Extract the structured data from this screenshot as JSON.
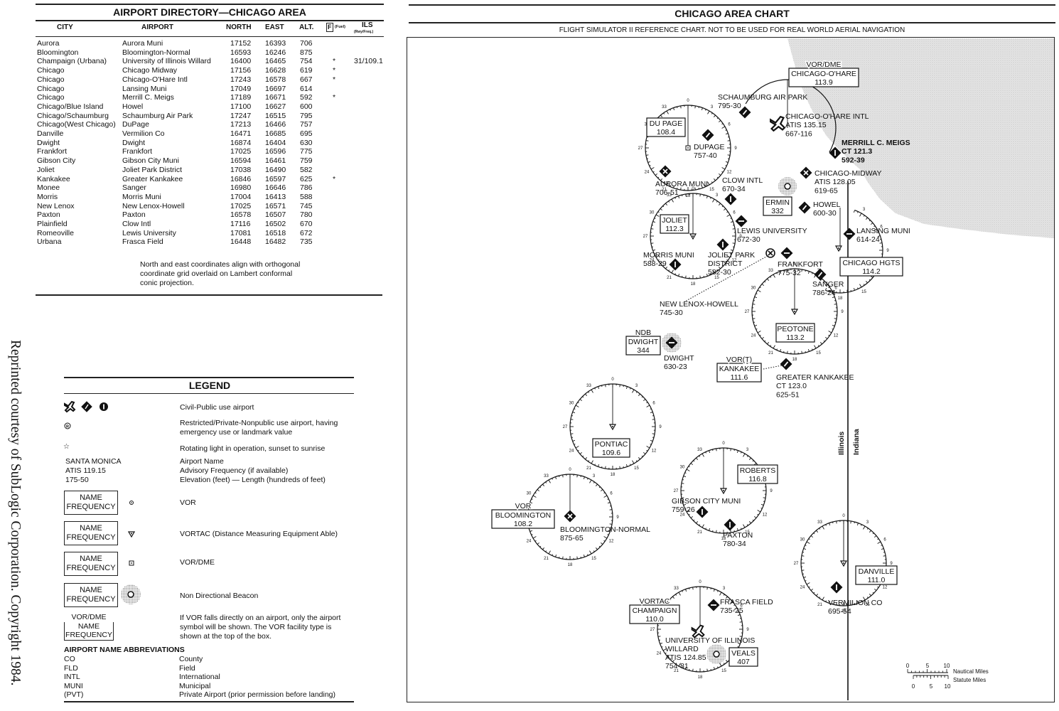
{
  "credit": "Reprinted courtesy of SubLogic Corporation. Copyright 1984.",
  "directory": {
    "title": "AIRPORT DIRECTORY—CHICAGO AREA",
    "columns": [
      "CITY",
      "AIRPORT",
      "NORTH",
      "EAST",
      "ALT.",
      "F",
      "(Fuel)",
      "ILS",
      "(Rwy/Freq.)"
    ],
    "rows": [
      {
        "city": "Aurora",
        "airport": "Aurora Muni",
        "north": "17152",
        "east": "16393",
        "alt": "706",
        "fuel": "",
        "ils": ""
      },
      {
        "city": "Bloomington",
        "airport": "Bloomington-Normal",
        "north": "16593",
        "east": "16246",
        "alt": "875",
        "fuel": "",
        "ils": ""
      },
      {
        "city": "Champaign (Urbana)",
        "airport": "University of Illinois Willard",
        "north": "16400",
        "east": "16465",
        "alt": "754",
        "fuel": "*",
        "ils": "31/109.1"
      },
      {
        "city": "Chicago",
        "airport": "Chicago Midway",
        "north": "17156",
        "east": "16628",
        "alt": "619",
        "fuel": "*",
        "ils": ""
      },
      {
        "city": "Chicago",
        "airport": "Chicago-O'Hare Intl",
        "north": "17243",
        "east": "16578",
        "alt": "667",
        "fuel": "*",
        "ils": ""
      },
      {
        "city": "Chicago",
        "airport": "Lansing Muni",
        "north": "17049",
        "east": "16697",
        "alt": "614",
        "fuel": "",
        "ils": ""
      },
      {
        "city": "Chicago",
        "airport": "Merrill C. Meigs",
        "north": "17189",
        "east": "16671",
        "alt": "592",
        "fuel": "*",
        "ils": ""
      },
      {
        "city": "Chicago/Blue Island",
        "airport": "Howel",
        "north": "17100",
        "east": "16627",
        "alt": "600",
        "fuel": "",
        "ils": ""
      },
      {
        "city": "Chicago/Schaumburg",
        "airport": "Schaumburg Air Park",
        "north": "17247",
        "east": "16515",
        "alt": "795",
        "fuel": "",
        "ils": ""
      },
      {
        "city": "Chicago(West Chicago)",
        "airport": "DuPage",
        "north": "17213",
        "east": "16466",
        "alt": "757",
        "fuel": "",
        "ils": ""
      },
      {
        "city": "Danville",
        "airport": "Vermilion Co",
        "north": "16471",
        "east": "16685",
        "alt": "695",
        "fuel": "",
        "ils": ""
      },
      {
        "city": "Dwight",
        "airport": "Dwight",
        "north": "16874",
        "east": "16404",
        "alt": "630",
        "fuel": "",
        "ils": ""
      },
      {
        "city": "Frankfort",
        "airport": "Frankfort",
        "north": "17025",
        "east": "16596",
        "alt": "775",
        "fuel": "",
        "ils": ""
      },
      {
        "city": "Gibson City",
        "airport": "Gibson City Muni",
        "north": "16594",
        "east": "16461",
        "alt": "759",
        "fuel": "",
        "ils": ""
      },
      {
        "city": "Joliet",
        "airport": "Joliet Park District",
        "north": "17038",
        "east": "16490",
        "alt": "582",
        "fuel": "",
        "ils": ""
      },
      {
        "city": "Kankakee",
        "airport": "Greater Kankakee",
        "north": "16846",
        "east": "16597",
        "alt": "625",
        "fuel": "*",
        "ils": ""
      },
      {
        "city": "Monee",
        "airport": "Sanger",
        "north": "16980",
        "east": "16646",
        "alt": "786",
        "fuel": "",
        "ils": ""
      },
      {
        "city": "Morris",
        "airport": "Morris Muni",
        "north": "17004",
        "east": "16413",
        "alt": "588",
        "fuel": "",
        "ils": ""
      },
      {
        "city": "New Lenox",
        "airport": "New Lenox-Howell",
        "north": "17025",
        "east": "16571",
        "alt": "745",
        "fuel": "",
        "ils": ""
      },
      {
        "city": "Paxton",
        "airport": "Paxton",
        "north": "16578",
        "east": "16507",
        "alt": "780",
        "fuel": "",
        "ils": ""
      },
      {
        "city": "Plainfield",
        "airport": "Clow Intl",
        "north": "17116",
        "east": "16502",
        "alt": "670",
        "fuel": "",
        "ils": ""
      },
      {
        "city": "Romeoville",
        "airport": "Lewis University",
        "north": "17081",
        "east": "16518",
        "alt": "672",
        "fuel": "",
        "ils": ""
      },
      {
        "city": "Urbana",
        "airport": "Frasca Field",
        "north": "16448",
        "east": "16482",
        "alt": "735",
        "fuel": "",
        "ils": ""
      }
    ],
    "note": "North and east coordinates align with orthogonal coordinate grid overlaid on Lambert conformal conic projection."
  },
  "legend": {
    "title": "LEGEND",
    "items": [
      {
        "symbol": "civil-airport-icons",
        "text": "Civil-Public use airport"
      },
      {
        "symbol": "restricted-airport-icon",
        "text": "Restricted/Private-Nonpublic use airport, having emergency use or landmark value"
      },
      {
        "symbol": "rotating-light-icon",
        "text": "Rotating light in operation, sunset to sunrise"
      },
      {
        "symbol": "airport-label-example",
        "example_lines": [
          "SANTA MONICA",
          "ATIS 119.15",
          "175-50"
        ],
        "text_lines": [
          "Airport Name",
          "Advisory Frequency (if available)",
          "Elevation (feet) — Length (hundreds of feet)"
        ]
      },
      {
        "symbol": "vor-icon",
        "box": [
          "NAME",
          "FREQUENCY"
        ],
        "text": "VOR"
      },
      {
        "symbol": "vortac-icon",
        "box": [
          "NAME",
          "FREQUENCY"
        ],
        "text": "VORTAC (Distance Measuring Equipment Able)"
      },
      {
        "symbol": "vor-dme-icon",
        "box": [
          "NAME",
          "FREQUENCY"
        ],
        "text": "VOR/DME"
      },
      {
        "symbol": "ndb-icon",
        "box": [
          "NAME",
          "FREQUENCY"
        ],
        "text": "Non Directional Beacon"
      },
      {
        "symbol": "facility-box",
        "box": [
          "VOR/DME",
          "NAME",
          "FREQUENCY"
        ],
        "text": "If VOR falls directly on an airport, only the airport symbol will be shown. The VOR facility type is shown at the top of the box."
      }
    ],
    "abbr_title": "AIRPORT NAME ABBREVIATIONS",
    "abbreviations": [
      {
        "abbr": "CO",
        "meaning": "County"
      },
      {
        "abbr": "FLD",
        "meaning": "Field"
      },
      {
        "abbr": "INTL",
        "meaning": "International"
      },
      {
        "abbr": "MUNI",
        "meaning": "Municipal"
      },
      {
        "abbr": "(PVT)",
        "meaning": "Private Airport (prior permission before landing)"
      }
    ]
  },
  "chart": {
    "title": "CHICAGO AREA CHART",
    "subtitle": "FLIGHT SIMULATOR II REFERENCE CHART.   NOT TO BE USED FOR REAL WORLD AERIAL NAVIGATION",
    "state_labels": [
      "Illinois",
      "Indiana"
    ],
    "compass_ticks": [
      "0",
      "3",
      "6",
      "9",
      "12",
      "15",
      "18",
      "21",
      "24",
      "27",
      "30",
      "33"
    ],
    "navaids": [
      {
        "type": "VOR/DME",
        "name": "CHICAGO-O'HARE",
        "freq": "113.9"
      },
      {
        "type": "VOR/DME",
        "name": "DU PAGE",
        "freq": "108.4"
      },
      {
        "type": "NDB",
        "name": "ERMIN",
        "freq": "332"
      },
      {
        "type": "VORTAC",
        "name": "JOLIET",
        "freq": "112.3"
      },
      {
        "type": "VORTAC",
        "name": "CHICAGO HGTS",
        "freq": "114.2"
      },
      {
        "type": "VORTAC",
        "name": "PEOTONE",
        "freq": "113.2"
      },
      {
        "type": "NDB",
        "name": "DWIGHT",
        "freq": "344"
      },
      {
        "type": "VOR(T)",
        "name": "KANKAKEE",
        "freq": "111.6"
      },
      {
        "type": "VORTAC",
        "name": "PONTIAC",
        "freq": "109.6"
      },
      {
        "type": "VOR",
        "name": "BLOOMINGTON",
        "freq": "108.2"
      },
      {
        "type": "VORTAC",
        "name": "ROBERTS",
        "freq": "116.8"
      },
      {
        "type": "VORTAC",
        "name": "DANVILLE",
        "freq": "111.0"
      },
      {
        "type": "VORTAC",
        "name": "CHAMPAIGN",
        "freq": "110.0"
      },
      {
        "type": "NDB",
        "name": "VEALS",
        "freq": "407"
      }
    ],
    "airports": [
      {
        "name": "SCHAUMBURG AIR PARK",
        "info": [
          "795-30"
        ]
      },
      {
        "name": "CHICAGO-O'HARE INTL",
        "info": [
          "ATIS 135.15",
          "667-116"
        ]
      },
      {
        "name": "DUPAGE",
        "info": [
          "757-40"
        ]
      },
      {
        "name": "MERRILL C. MEIGS",
        "info": [
          "CT 121.3",
          "592-39"
        ]
      },
      {
        "name": "CHICAGO-MIDWAY",
        "info": [
          "ATIS 128.05",
          "619-65"
        ]
      },
      {
        "name": "AURORA MUNI",
        "info": [
          "706-51"
        ]
      },
      {
        "name": "CLOW INTL",
        "info": [
          "670-34"
        ]
      },
      {
        "name": "HOWEL",
        "info": [
          "600-30"
        ]
      },
      {
        "name": "LEWIS UNIVERSITY",
        "info": [
          "672-30"
        ]
      },
      {
        "name": "LANSING MUNI",
        "info": [
          "614-24"
        ]
      },
      {
        "name": "MORRIS MUNI",
        "info": [
          "588-29"
        ]
      },
      {
        "name": "JOLIET PARK DISTRICT",
        "info": [
          "582-30"
        ]
      },
      {
        "name": "FRANKFORT",
        "info": [
          "775-32"
        ]
      },
      {
        "name": "SANGER",
        "info": [
          "786-24"
        ]
      },
      {
        "name": "NEW LENOX-HOWELL",
        "info": [
          "745-30"
        ]
      },
      {
        "name": "DWIGHT",
        "info": [
          "630-23"
        ]
      },
      {
        "name": "GREATER KANKAKEE",
        "info": [
          "CT 123.0",
          "625-51"
        ]
      },
      {
        "name": "BLOOMINGTON-NORMAL",
        "info": [
          "875-65"
        ]
      },
      {
        "name": "GIBSON CITY MUNI",
        "info": [
          "759-26"
        ]
      },
      {
        "name": "PAXTON",
        "info": [
          "780-34"
        ]
      },
      {
        "name": "VERMILION CO",
        "info": [
          "695-54"
        ]
      },
      {
        "name": "FRASCA FIELD",
        "info": [
          "735-25"
        ]
      },
      {
        "name": "UNIVERSITY OF ILLINOIS WILLARD",
        "info": [
          "ATIS 124.85",
          "754-81"
        ]
      }
    ],
    "scale": {
      "nautical_label": "Nautical Miles",
      "statute_label": "Statute Miles",
      "ticks": [
        "0",
        "5",
        "10"
      ]
    }
  }
}
